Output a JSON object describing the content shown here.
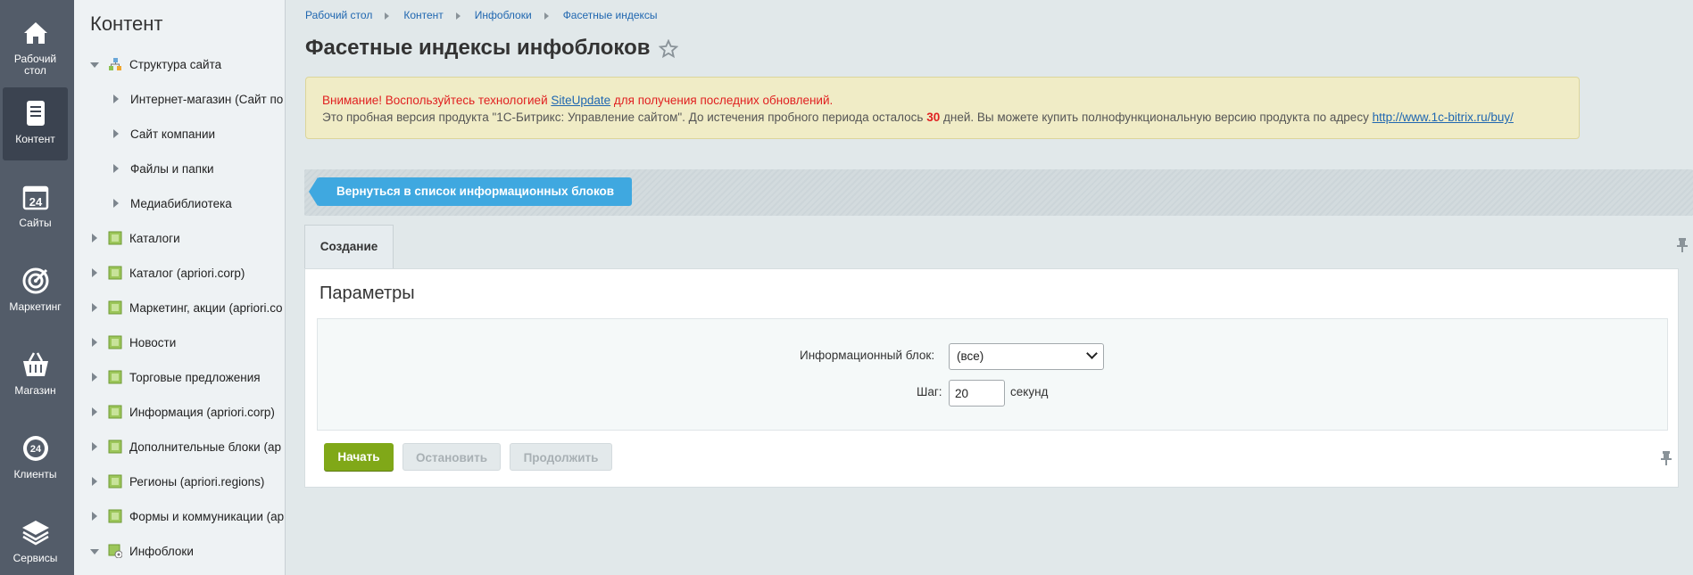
{
  "iconbar": {
    "items": [
      {
        "label": "Рабочий стол",
        "icon": "home-icon"
      },
      {
        "label": "Контент",
        "icon": "document-icon",
        "active": true
      },
      {
        "label": "Сайты",
        "icon": "calendar-24-icon"
      },
      {
        "label": "Маркетинг",
        "icon": "target-icon"
      },
      {
        "label": "Магазин",
        "icon": "basket-icon"
      },
      {
        "label": "Клиенты",
        "icon": "crm-24-icon"
      },
      {
        "label": "Сервисы",
        "icon": "layers-icon"
      }
    ]
  },
  "tree": {
    "title": "Контент",
    "items": [
      {
        "label": "Структура сайта",
        "level": 0,
        "expanded": true,
        "icon": "site-structure-icon"
      },
      {
        "label": "Интернет-магазин (Сайт по",
        "level": 1
      },
      {
        "label": "Сайт компании",
        "level": 1
      },
      {
        "label": "Файлы и папки",
        "level": 1
      },
      {
        "label": "Медиабиблиотека",
        "level": 1
      },
      {
        "label": "Каталоги",
        "level": 0,
        "icon": "iblock-icon"
      },
      {
        "label": "Каталог (apriori.corp)",
        "level": 0,
        "icon": "iblock-icon"
      },
      {
        "label": "Маркетинг, акции (apriori.co",
        "level": 0,
        "icon": "iblock-icon"
      },
      {
        "label": "Новости",
        "level": 0,
        "icon": "iblock-icon"
      },
      {
        "label": "Торговые предложения",
        "level": 0,
        "icon": "iblock-icon"
      },
      {
        "label": "Информация (apriori.corp)",
        "level": 0,
        "icon": "iblock-icon"
      },
      {
        "label": "Дополнительные блоки (ар",
        "level": 0,
        "icon": "iblock-icon"
      },
      {
        "label": "Регионы (apriori.regions)",
        "level": 0,
        "icon": "iblock-icon"
      },
      {
        "label": "Формы и коммуникации (ар",
        "level": 0,
        "icon": "iblock-icon"
      },
      {
        "label": "Инфоблоки",
        "level": 0,
        "expanded": true,
        "icon": "iblock-settings-icon"
      }
    ]
  },
  "breadcrumbs": [
    "Рабочий стол",
    "Контент",
    "Инфоблоки",
    "Фасетные индексы"
  ],
  "page_title": "Фасетные индексы инфоблоков",
  "alert": {
    "warn_prefix": "Внимание! Воспользуйтесь технологией ",
    "link1": "SiteUpdate",
    "warn_suffix": " для получения последних обновлений.",
    "trial_prefix": "Это пробная версия продукта \"1С-Битрикс: Управление сайтом\". До истечения пробного периода осталось ",
    "days": "30",
    "trial_suffix": " дней. Вы можете купить полнофункциональную версию продукта по адресу ",
    "link2": "http://www.1c-bitrix.ru/buy/"
  },
  "toolbar": {
    "back_label": "Вернуться в список информационных блоков"
  },
  "tabs": [
    {
      "label": "Создание"
    }
  ],
  "form": {
    "title": "Параметры",
    "iblock_label": "Информационный блок:",
    "iblock_value": "(все)",
    "step_label": "Шаг:",
    "step_value": "20",
    "step_unit": "секунд"
  },
  "buttons": {
    "start": "Начать",
    "stop": "Остановить",
    "continue": "Продолжить"
  },
  "colors": {
    "accent_blue": "#3fa8e0",
    "start_green": "#80a818",
    "warning_red": "#e02020"
  }
}
